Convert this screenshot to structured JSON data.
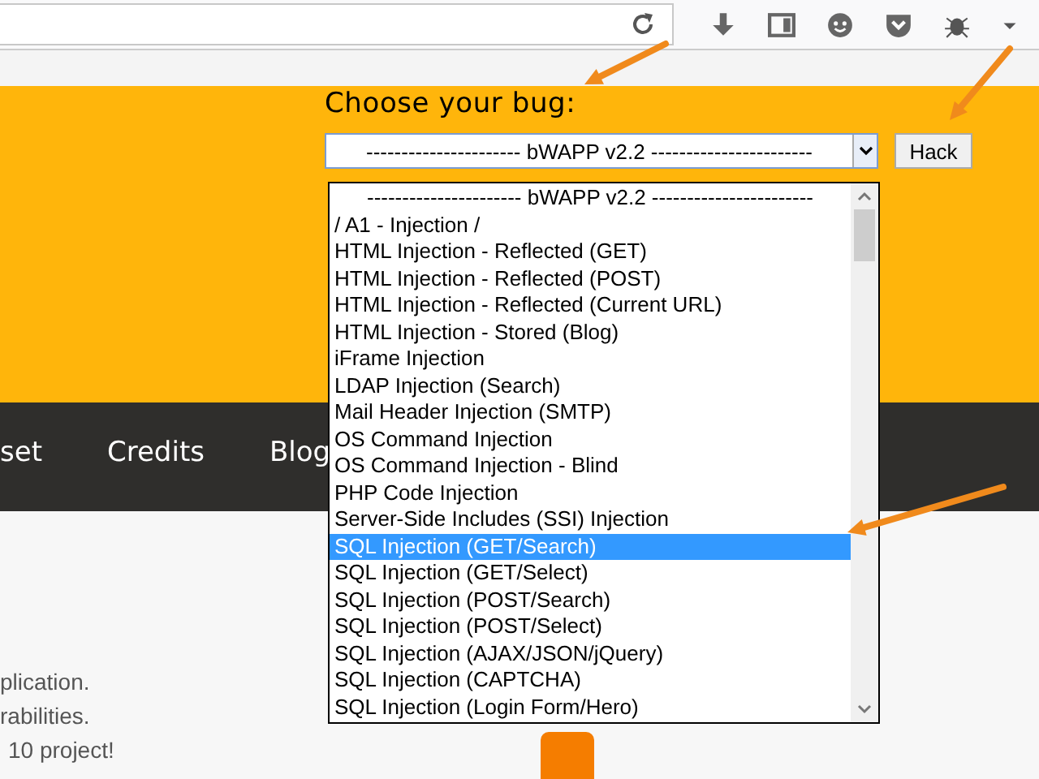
{
  "header": {
    "title": "Choose your bug:",
    "select_value": "---------------------- bWAPP v2.2 -----------------------",
    "button": "Hack"
  },
  "nav": [
    "set",
    "Credits",
    "Blog"
  ],
  "content": [
    "plication.",
    "rabilities.",
    "10 project!"
  ],
  "dropdown": [
    {
      "label": "---------------------- bWAPP v2.2 -----------------------",
      "selected": false
    },
    {
      "label": "/ A1 - Injection /",
      "selected": false
    },
    {
      "label": "HTML Injection - Reflected (GET)",
      "selected": false
    },
    {
      "label": "HTML Injection - Reflected (POST)",
      "selected": false
    },
    {
      "label": "HTML Injection - Reflected (Current URL)",
      "selected": false
    },
    {
      "label": "HTML Injection - Stored (Blog)",
      "selected": false
    },
    {
      "label": "iFrame Injection",
      "selected": false
    },
    {
      "label": "LDAP Injection (Search)",
      "selected": false
    },
    {
      "label": "Mail Header Injection (SMTP)",
      "selected": false
    },
    {
      "label": "OS Command Injection",
      "selected": false
    },
    {
      "label": "OS Command Injection - Blind",
      "selected": false
    },
    {
      "label": "PHP Code Injection",
      "selected": false
    },
    {
      "label": "Server-Side Includes (SSI) Injection",
      "selected": false
    },
    {
      "label": "SQL Injection (GET/Search)",
      "selected": true
    },
    {
      "label": "SQL Injection (GET/Select)",
      "selected": false
    },
    {
      "label": "SQL Injection (POST/Search)",
      "selected": false
    },
    {
      "label": "SQL Injection (POST/Select)",
      "selected": false
    },
    {
      "label": "SQL Injection (AJAX/JSON/jQuery)",
      "selected": false
    },
    {
      "label": "SQL Injection (CAPTCHA)",
      "selected": false
    },
    {
      "label": "SQL Injection (Login Form/Hero)",
      "selected": false
    }
  ]
}
